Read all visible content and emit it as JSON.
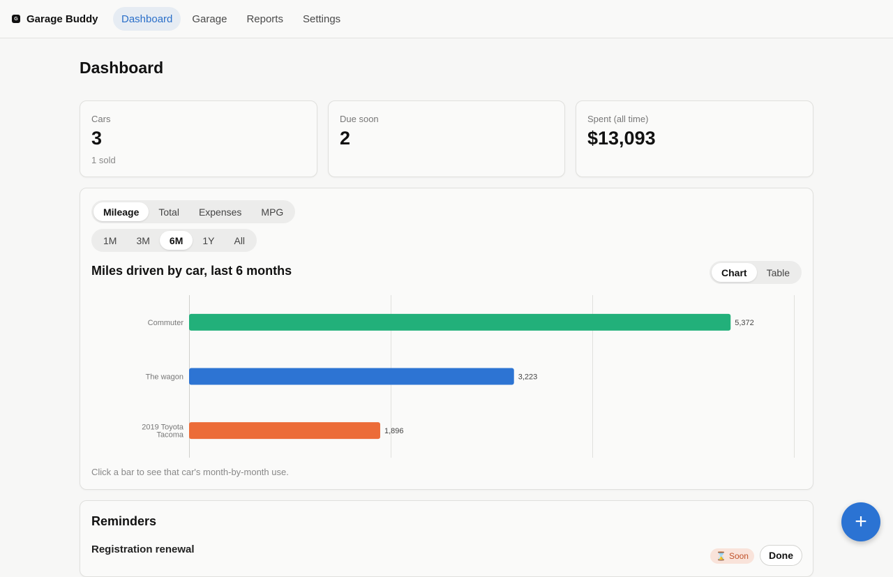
{
  "app": {
    "name": "Garage Buddy",
    "logo_letter": "G",
    "nav": [
      {
        "label": "Dashboard",
        "active": true
      },
      {
        "label": "Garage",
        "active": false
      },
      {
        "label": "Reports",
        "active": false
      },
      {
        "label": "Settings",
        "active": false
      }
    ]
  },
  "page": {
    "title": "Dashboard"
  },
  "stats": [
    {
      "label": "Cars",
      "value": "3",
      "sub": "1 sold"
    },
    {
      "label": "Due soon",
      "value": "2",
      "sub": ""
    },
    {
      "label": "Spent (all time)",
      "value": "$13,093",
      "sub": ""
    }
  ],
  "metric_tabs": [
    {
      "label": "Mileage",
      "active": true
    },
    {
      "label": "Total",
      "active": false
    },
    {
      "label": "Expenses",
      "active": false
    },
    {
      "label": "MPG",
      "active": false
    }
  ],
  "range_tabs": [
    {
      "label": "1M",
      "active": false
    },
    {
      "label": "3M",
      "active": false
    },
    {
      "label": "6M",
      "active": true
    },
    {
      "label": "1Y",
      "active": false
    },
    {
      "label": "All",
      "active": false
    }
  ],
  "view_tabs": [
    {
      "label": "Chart",
      "active": true
    },
    {
      "label": "Table",
      "active": false
    }
  ],
  "chart_note": "Click a bar to see that car's month-by-month use.",
  "chart_data": {
    "type": "bar",
    "orientation": "horizontal",
    "title": "Miles driven by car, last 6 months",
    "categories": [
      "Commuter",
      "The wagon",
      "2019 Toyota Tacoma"
    ],
    "values": [
      5372,
      3223,
      1896
    ],
    "value_labels": [
      "5,372",
      "3,223",
      "1,896"
    ],
    "colors": [
      "#22b07a",
      "#2d74d3",
      "#ec6c38"
    ],
    "xlim": [
      0,
      6000
    ],
    "grid": true,
    "xlabel": "",
    "ylabel": ""
  },
  "reminders": {
    "title": "Reminders",
    "items": [
      {
        "name": "Registration renewal",
        "badge": "Soon",
        "badge_icon": "hourglass-icon",
        "action": "Done"
      }
    ]
  },
  "fab": {
    "icon": "plus-icon",
    "symbol": "+"
  }
}
